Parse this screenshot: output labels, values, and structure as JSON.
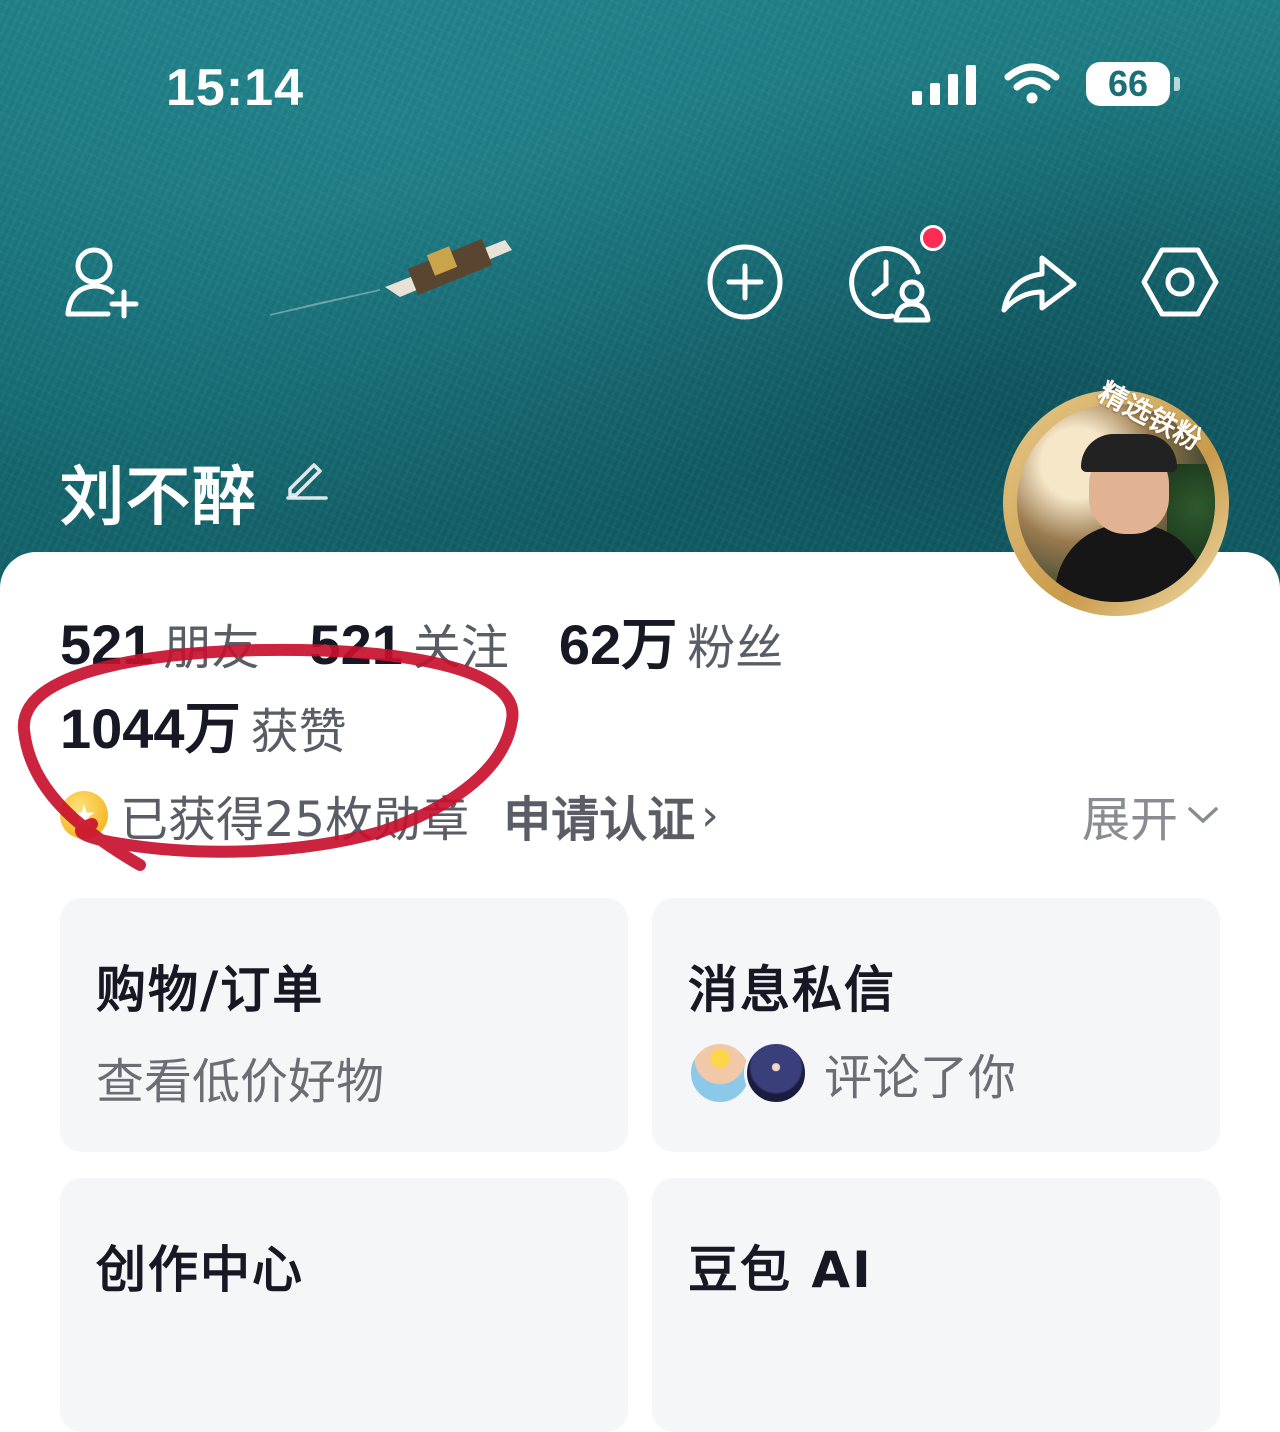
{
  "status_bar": {
    "time": "15:14",
    "battery": "66"
  },
  "header": {
    "add_friend_icon": "add-friend-icon",
    "actions": [
      "plus-circle-icon",
      "visitor-history-icon",
      "share-icon",
      "settings-icon"
    ]
  },
  "profile": {
    "username": "刘不醉",
    "avatar_badge": "精选铁粉",
    "stats": [
      {
        "value": "521",
        "label": "朋友"
      },
      {
        "value": "521",
        "label": "关注"
      },
      {
        "value": "62万",
        "label": "粉丝"
      }
    ],
    "likes": {
      "value": "1044万",
      "label": "获赞"
    },
    "badges_text": "已获得25枚勋章",
    "certify_label": "申请认证",
    "expand_label": "展开"
  },
  "tiles": [
    {
      "title": "购物/订单",
      "subtitle": "查看低价好物"
    },
    {
      "title": "消息私信",
      "subtitle": "评论了你"
    },
    {
      "title": "创作中心"
    },
    {
      "title": "豆包 AI"
    }
  ],
  "colors": {
    "hero": "#176f77",
    "notification": "#fe2c55",
    "annotation": "#c8102e"
  }
}
